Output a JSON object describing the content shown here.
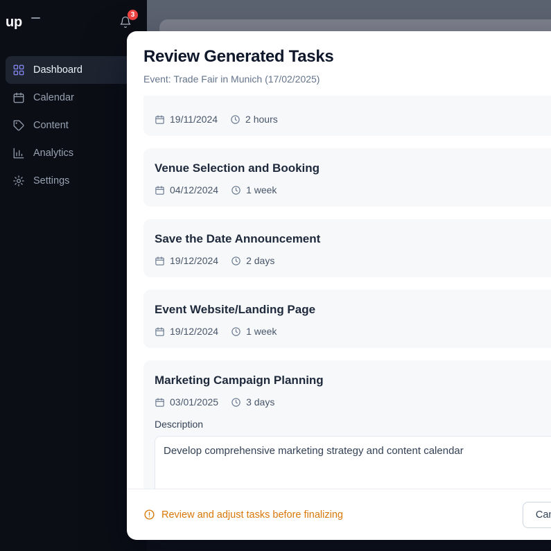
{
  "sidebar": {
    "logo_text": "up",
    "notifications_badge": "3",
    "items": [
      {
        "label": "Dashboard",
        "icon": "dashboard-grid-icon"
      },
      {
        "label": "Calendar",
        "icon": "calendar-icon"
      },
      {
        "label": "Content",
        "icon": "tag-icon"
      },
      {
        "label": "Analytics",
        "icon": "bar-chart-icon"
      },
      {
        "label": "Settings",
        "icon": "gear-icon"
      }
    ]
  },
  "modal": {
    "title": "Review Generated Tasks",
    "subtitle": "Event: Trade Fair in Munich (17/02/2025)",
    "tasks": [
      {
        "title": "",
        "date": "19/11/2024",
        "duration": "2 hours"
      },
      {
        "title": "Venue Selection and Booking",
        "date": "04/12/2024",
        "duration": "1 week"
      },
      {
        "title": "Save the Date Announcement",
        "date": "19/12/2024",
        "duration": "2 days"
      },
      {
        "title": "Event Website/Landing Page",
        "date": "19/12/2024",
        "duration": "1 week"
      },
      {
        "title": "Marketing Campaign Planning",
        "date": "03/01/2025",
        "duration": "3 days",
        "description_label": "Description",
        "description": "Develop comprehensive marketing strategy and content calendar"
      }
    ],
    "footer": {
      "warning_text": "Review and adjust tasks before finalizing",
      "cancel_label": "Cancel"
    }
  },
  "colors": {
    "accent_purple": "#8789f6",
    "warning_amber": "#d97706",
    "badge_red": "#ef4444"
  }
}
